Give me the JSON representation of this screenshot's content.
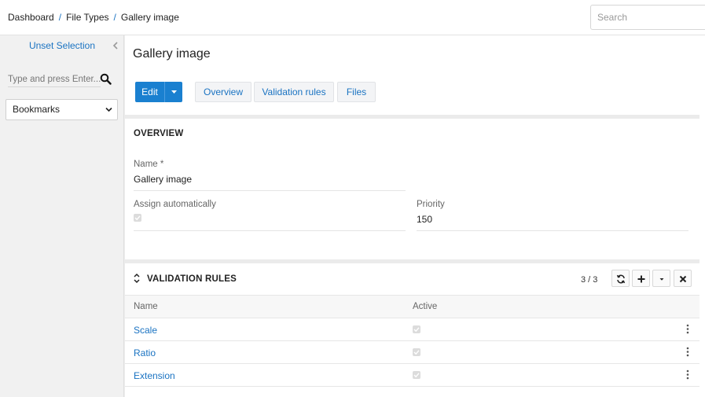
{
  "breadcrumb": {
    "items": [
      "Dashboard",
      "File Types",
      "Gallery image"
    ],
    "separator": "/"
  },
  "header": {
    "search_placeholder": "Search"
  },
  "sidebar": {
    "unset_label": "Unset Selection",
    "search_placeholder": "Type and press Enter...",
    "bookmarks_label": "Bookmarks"
  },
  "page": {
    "title": "Gallery image"
  },
  "toolbar": {
    "edit_label": "Edit",
    "tabs": [
      "Overview",
      "Validation rules",
      "Files"
    ]
  },
  "overview": {
    "title": "OVERVIEW",
    "name_label": "Name *",
    "name_value": "Gallery image",
    "assign_label": "Assign automatically",
    "assign_checked": true,
    "priority_label": "Priority",
    "priority_value": "150"
  },
  "validation_rules": {
    "title": "VALIDATION RULES",
    "count": "3 / 3",
    "columns": [
      "Name",
      "Active"
    ],
    "rows": [
      {
        "name": "Scale",
        "active": true
      },
      {
        "name": "Ratio",
        "active": true
      },
      {
        "name": "Extension",
        "active": true
      }
    ]
  },
  "colors": {
    "accent": "#1a80d0",
    "link": "#1a73c2"
  }
}
